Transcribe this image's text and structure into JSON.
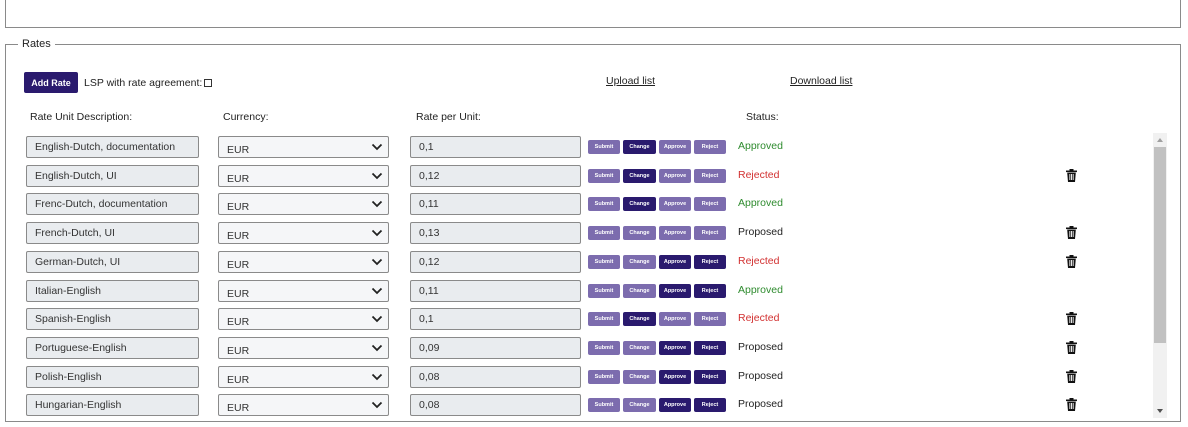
{
  "section": {
    "legend": "Rates",
    "add_rate_label": "Add Rate",
    "lsp_label": "LSP with rate agreement:",
    "upload_label": "Upload list",
    "download_label": "Download list"
  },
  "columns": {
    "description": "Rate Unit Description:",
    "currency": "Currency:",
    "rate": "Rate per Unit:",
    "status": "Status:"
  },
  "buttons": {
    "submit": "Submit",
    "change": "Change",
    "approve": "Approve",
    "reject": "Reject"
  },
  "colors": {
    "approved": "#2e8b2e",
    "rejected": "#d23030",
    "proposed": "#222222",
    "button_dark": "#2a1a6e",
    "button_light": "#7c6cae"
  },
  "rows": [
    {
      "description": "English-Dutch, documentation",
      "currency": "EUR",
      "rate": "0,1",
      "status": "Approved",
      "status_type": "approved",
      "change_active": true,
      "approve_active": false,
      "reject_active": false,
      "delete": false
    },
    {
      "description": "English-Dutch, UI",
      "currency": "EUR",
      "rate": "0,12",
      "status": "Rejected",
      "status_type": "rejected",
      "change_active": true,
      "approve_active": false,
      "reject_active": false,
      "delete": true
    },
    {
      "description": "Frenc-Dutch, documentation",
      "currency": "EUR",
      "rate": "0,11",
      "status": "Approved",
      "status_type": "approved",
      "change_active": true,
      "approve_active": false,
      "reject_active": false,
      "delete": false
    },
    {
      "description": "French-Dutch, UI",
      "currency": "EUR",
      "rate": "0,13",
      "status": "Proposed",
      "status_type": "proposed",
      "change_active": false,
      "approve_active": false,
      "reject_active": false,
      "delete": true
    },
    {
      "description": "German-Dutch, UI",
      "currency": "EUR",
      "rate": "0,12",
      "status": "Rejected",
      "status_type": "rejected",
      "change_active": false,
      "approve_active": true,
      "reject_active": true,
      "delete": true
    },
    {
      "description": "Italian-English",
      "currency": "EUR",
      "rate": "0,11",
      "status": "Approved",
      "status_type": "approved",
      "change_active": false,
      "approve_active": true,
      "reject_active": true,
      "delete": false
    },
    {
      "description": "Spanish-English",
      "currency": "EUR",
      "rate": "0,1",
      "status": "Rejected",
      "status_type": "rejected",
      "change_active": true,
      "approve_active": false,
      "reject_active": false,
      "delete": true
    },
    {
      "description": "Portuguese-English",
      "currency": "EUR",
      "rate": "0,09",
      "status": "Proposed",
      "status_type": "proposed",
      "change_active": false,
      "approve_active": true,
      "reject_active": true,
      "delete": true
    },
    {
      "description": "Polish-English",
      "currency": "EUR",
      "rate": "0,08",
      "status": "Proposed",
      "status_type": "proposed",
      "change_active": false,
      "approve_active": true,
      "reject_active": true,
      "delete": true
    },
    {
      "description": "Hungarian-English",
      "currency": "EUR",
      "rate": "0,08",
      "status": "Proposed",
      "status_type": "proposed",
      "change_active": false,
      "approve_active": true,
      "reject_active": true,
      "delete": true
    }
  ]
}
